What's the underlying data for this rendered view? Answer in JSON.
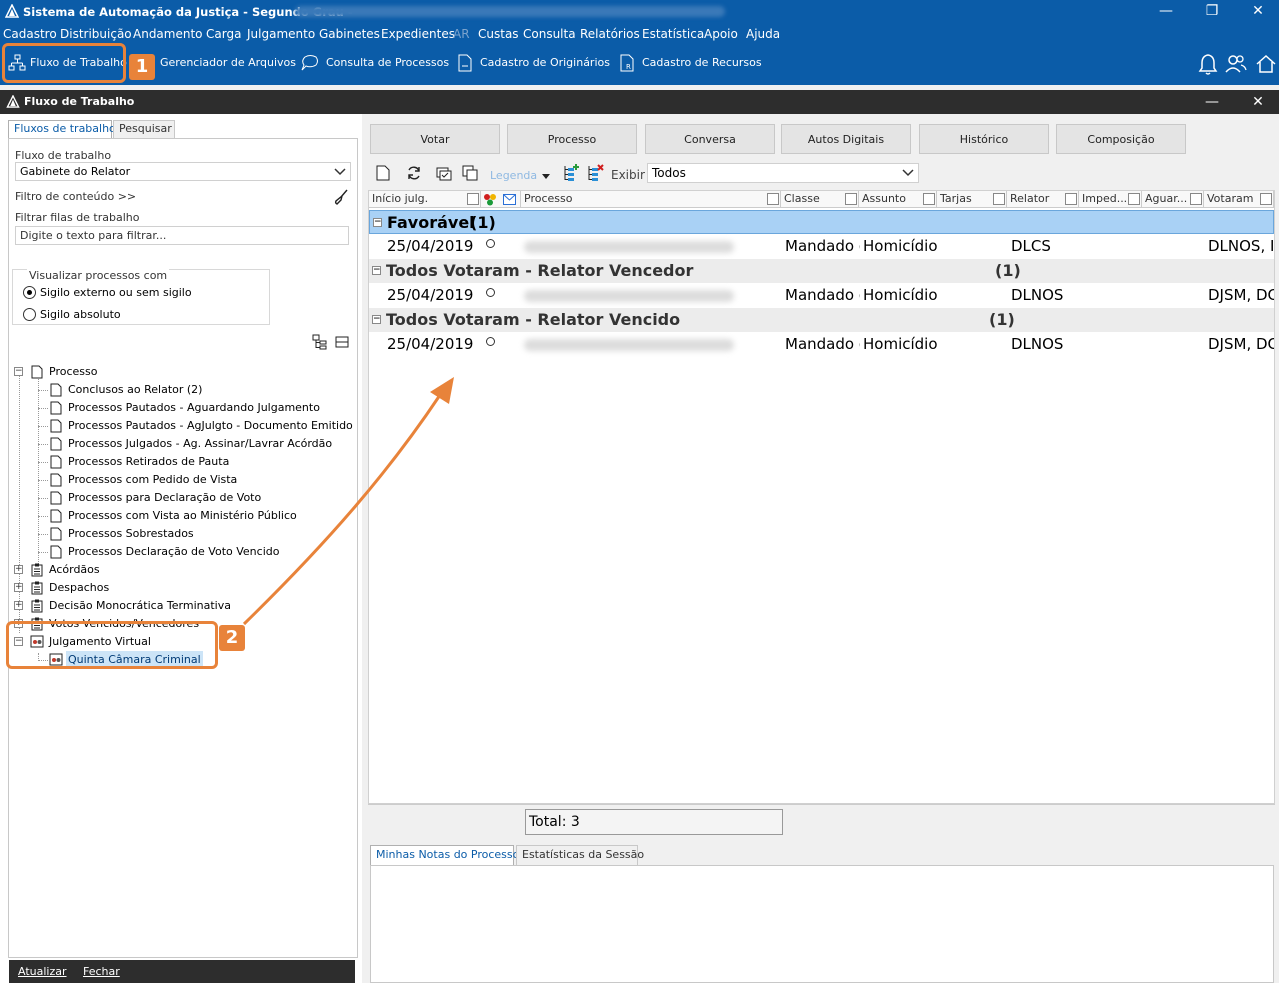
{
  "window": {
    "title": "Sistema de Automação da Justiça - Segundo Grau -"
  },
  "menu": [
    "Cadastro",
    "Distribuição",
    "Andamento",
    "Carga",
    "Julgamento",
    "Gabinetes",
    "Expedientes",
    "AR",
    "Custas",
    "Consulta",
    "Relatórios",
    "Estatística",
    "Apoio",
    "Ajuda"
  ],
  "toolbar": {
    "fluxo": "Fluxo de Trabalho",
    "arquivos": "Gerenciador de Arquivos",
    "consulta": "Consulta de Processos",
    "originarios": "Cadastro de Originários",
    "recursos": "Cadastro de Recursos"
  },
  "panel": {
    "title": "Fluxo de Trabalho"
  },
  "left": {
    "tabs": [
      "Fluxos de trabalho",
      "Pesquisar"
    ],
    "fluxo_label": "Fluxo de trabalho",
    "fluxo_value": "Gabinete do Relator",
    "filtro_conteudo": "Filtro de conteúdo >>",
    "filtrar_label": "Filtrar filas de trabalho",
    "filtrar_placeholder": "Digite o texto para filtrar...",
    "visualizar_label": "Visualizar processos com",
    "radio1": "Sigilo externo ou sem sigilo",
    "radio2": "Sigilo absoluto",
    "tree_root": "Processo",
    "tree_children": [
      "Conclusos ao Relator (2)",
      "Processos Pautados - Aguardando Julgamento",
      "Processos Pautados - AgJulgto - Documento Emitido",
      "Processos Julgados - Ag. Assinar/Lavrar Acórdão",
      "Processos Retirados de Pauta",
      "Processos com Pedido de Vista",
      "Processos para Declaração de Voto",
      "Processos com Vista ao Ministério Público",
      "Processos Sobrestados",
      "Processos Declaração de Voto Vencido"
    ],
    "tree_other": [
      "Acórdãos",
      "Despachos",
      "Decisão Monocrática Terminativa",
      "Votos Vencidos/Vencedores"
    ],
    "tree_virtual": "Julgamento Virtual",
    "tree_virtual_child": "Quinta Câmara Criminal",
    "atualizar": "Atualizar",
    "fechar": "Fechar"
  },
  "right": {
    "tabs": [
      "Votar",
      "Processo",
      "Conversa",
      "Autos Digitais",
      "Histórico",
      "Composição"
    ],
    "legenda": "Legenda",
    "exibir_label": "Exibir",
    "exibir_value": "Todos",
    "columns": [
      "Início julg.",
      "Processo",
      "Classe",
      "Assunto",
      "Tarjas",
      "Relator",
      "Imped...",
      "Aguar...",
      "Votaram"
    ],
    "groups": [
      {
        "title": "Favorável",
        "count": "(1)",
        "row": {
          "date": "25/04/2019",
          "status": "#1a9a3a",
          "classe": "Mandado d",
          "assunto": "Homicídio",
          "relator": "DLCS",
          "votaram": "DLNOS, I"
        }
      },
      {
        "title": "Todos Votaram - Relator Vencedor",
        "count": "(1)",
        "row": {
          "date": "25/04/2019",
          "status": "#1a9a3a",
          "classe": "Mandado d",
          "assunto": "Homicídio",
          "relator": "DLNOS",
          "votaram": "DJSM, DC"
        }
      },
      {
        "title": "Todos Votaram - Relator Vencido",
        "count": "(1)",
        "row": {
          "date": "25/04/2019",
          "status": "#d01e1e",
          "classe": "Mandado d",
          "assunto": "Homicídio",
          "relator": "DLNOS",
          "votaram": "DJSM, DC"
        }
      }
    ],
    "total": "Total: 3",
    "notes_tabs": [
      "Minhas Notas do Processo",
      "Estatísticas da Sessão"
    ]
  },
  "annotations": {
    "badge1": "1",
    "badge2": "2",
    "color": "#e8833a"
  }
}
